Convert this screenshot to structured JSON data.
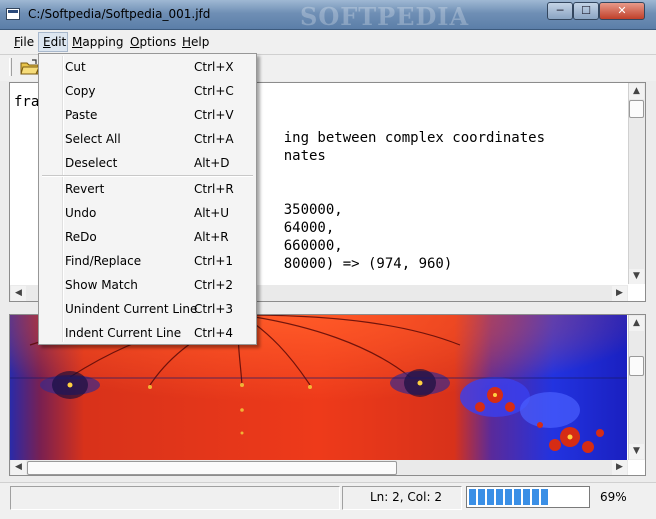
{
  "window": {
    "title": "C:/Softpedia/Softpedia_001.jfd",
    "watermark": "SOFTPEDIA"
  },
  "menubar": [
    {
      "accel": "F",
      "rest": "ile"
    },
    {
      "accel": "E",
      "rest": "dit"
    },
    {
      "accel": "M",
      "rest": "apping"
    },
    {
      "accel": "O",
      "rest": "ptions"
    },
    {
      "accel": "H",
      "rest": "elp"
    }
  ],
  "edit_menu": [
    {
      "label": "Cut",
      "shortcut": "Ctrl+X"
    },
    {
      "label": "Copy",
      "shortcut": "Ctrl+C"
    },
    {
      "label": "Paste",
      "shortcut": "Ctrl+V"
    },
    {
      "label": "Select All",
      "shortcut": "Ctrl+A"
    },
    {
      "label": "Deselect",
      "shortcut": "Alt+D"
    },
    {
      "label": "Revert",
      "shortcut": "Ctrl+R"
    },
    {
      "label": "Undo",
      "shortcut": "Alt+U"
    },
    {
      "label": "ReDo",
      "shortcut": "Alt+R"
    },
    {
      "label": "Find/Replace",
      "shortcut": "Ctrl+1"
    },
    {
      "label": "Show Match",
      "shortcut": "Ctrl+2"
    },
    {
      "label": "Unindent Current Line",
      "shortcut": "Ctrl+3"
    },
    {
      "label": "Indent Current Line",
      "shortcut": "Ctrl+4"
    }
  ],
  "editor": {
    "lines": [
      "fra",
      "",
      "                                ing between complex coordinates",
      "                                nates",
      "",
      "",
      "                                350000,",
      "                                64000,",
      "                                660000,",
      "                                80000) => (974, 960)"
    ]
  },
  "status": {
    "position": "Ln: 2, Col: 2",
    "progress_pct": 69,
    "progress_label": "69%"
  },
  "colors": {
    "fractal_bg": "#e3381c",
    "fractal_blue": "#1f2bd6",
    "progress": "#3a8fe6"
  },
  "icons": [
    "open-folder-icon",
    "minimize-icon",
    "maximize-icon",
    "close-icon",
    "chevron-up-icon",
    "chevron-down-icon",
    "chevron-left-icon",
    "chevron-right-icon"
  ]
}
